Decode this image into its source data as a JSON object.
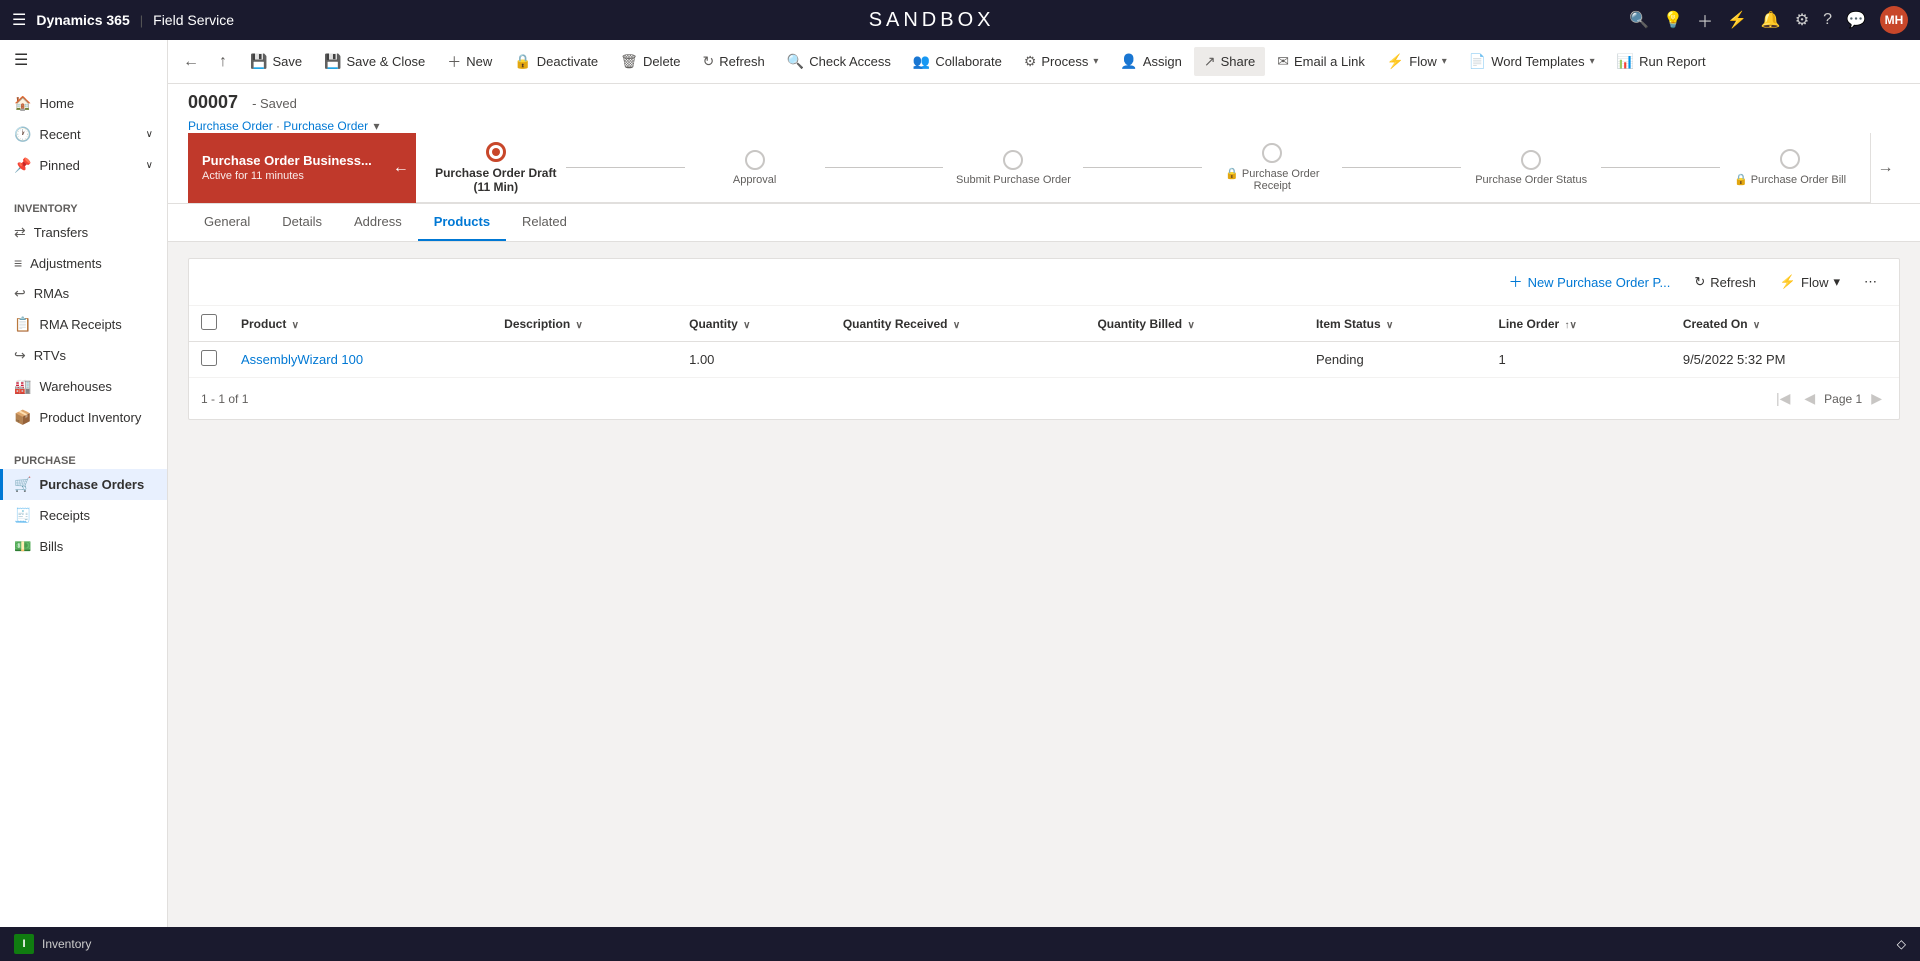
{
  "app": {
    "platform": "Dynamics 365",
    "module": "Field Service",
    "sandbox_label": "SANDBOX"
  },
  "top_nav_icons": [
    "search",
    "lightbulb",
    "plus",
    "filter",
    "bell",
    "settings",
    "help",
    "chat",
    "avatar"
  ],
  "avatar": {
    "initials": "MH"
  },
  "cmd_bar": {
    "back_label": "←",
    "forward_label": "→",
    "save_label": "Save",
    "save_close_label": "Save & Close",
    "new_label": "New",
    "deactivate_label": "Deactivate",
    "delete_label": "Delete",
    "refresh_label": "Refresh",
    "check_access_label": "Check Access",
    "collaborate_label": "Collaborate",
    "process_label": "Process",
    "assign_label": "Assign",
    "share_label": "Share",
    "email_link_label": "Email a Link",
    "flow_label": "Flow",
    "word_templates_label": "Word Templates",
    "run_report_label": "Run Report"
  },
  "record": {
    "id": "00007",
    "status": "Saved",
    "breadcrumb1": "Purchase Order",
    "breadcrumb2": "Purchase Order"
  },
  "process_stages": [
    {
      "label": "Purchase Order Draft (11 Min)",
      "state": "active"
    },
    {
      "label": "Approval",
      "state": "pending"
    },
    {
      "label": "Submit Purchase Order",
      "state": "pending"
    },
    {
      "label": "Purchase Order Receipt",
      "state": "pending",
      "locked": true
    },
    {
      "label": "Purchase Order Status",
      "state": "pending"
    },
    {
      "label": "Purchase Order Bill",
      "state": "pending",
      "locked": true
    }
  ],
  "active_stage": {
    "title": "Purchase Order Business...",
    "sub": "Active for 11 minutes"
  },
  "tabs": [
    {
      "label": "General",
      "active": false
    },
    {
      "label": "Details",
      "active": false
    },
    {
      "label": "Address",
      "active": false
    },
    {
      "label": "Products",
      "active": true
    },
    {
      "label": "Related",
      "active": false
    }
  ],
  "products_panel": {
    "new_btn": "New Purchase Order P...",
    "refresh_btn": "Refresh",
    "flow_btn": "Flow",
    "more_btn": "⋯",
    "columns": [
      {
        "label": "Product",
        "sortable": true
      },
      {
        "label": "Description",
        "sortable": true
      },
      {
        "label": "Quantity",
        "sortable": true
      },
      {
        "label": "Quantity Received",
        "sortable": true
      },
      {
        "label": "Quantity Billed",
        "sortable": true
      },
      {
        "label": "Item Status",
        "sortable": true
      },
      {
        "label": "Line Order",
        "sortable": true
      },
      {
        "label": "Created On",
        "sortable": true
      }
    ],
    "rows": [
      {
        "product": "AssemblyWizard 100",
        "description": "",
        "quantity": "1.00",
        "quantity_received": "",
        "quantity_billed": "",
        "item_status": "Pending",
        "line_order": "1",
        "created_on": "9/5/2022 5:32 PM"
      }
    ],
    "pagination": {
      "range": "1 - 1 of 1",
      "page_label": "Page 1"
    }
  },
  "sidebar": {
    "sections": [
      {
        "label": "Inventory",
        "items": [
          {
            "label": "Transfers",
            "icon": "↔",
            "active": false
          },
          {
            "label": "Adjustments",
            "icon": "≡",
            "active": false
          },
          {
            "label": "RMAs",
            "icon": "↩",
            "active": false
          },
          {
            "label": "RMA Receipts",
            "icon": "📋",
            "active": false
          },
          {
            "label": "RTVs",
            "icon": "↪",
            "active": false
          },
          {
            "label": "Warehouses",
            "icon": "🏭",
            "active": false
          },
          {
            "label": "Product Inventory",
            "icon": "📦",
            "active": false
          }
        ]
      },
      {
        "label": "Purchase",
        "items": [
          {
            "label": "Purchase Orders",
            "icon": "🛒",
            "active": true
          },
          {
            "label": "Receipts",
            "icon": "🧾",
            "active": false
          },
          {
            "label": "Bills",
            "icon": "💵",
            "active": false
          }
        ]
      }
    ],
    "top_items": [
      {
        "label": "Home",
        "icon": "🏠"
      },
      {
        "label": "Recent",
        "icon": "🕐",
        "expandable": true
      },
      {
        "label": "Pinned",
        "icon": "📌",
        "expandable": true
      }
    ]
  },
  "bottom_bar": {
    "indicator": "I",
    "label": "Inventory",
    "expand_icon": "◇"
  }
}
